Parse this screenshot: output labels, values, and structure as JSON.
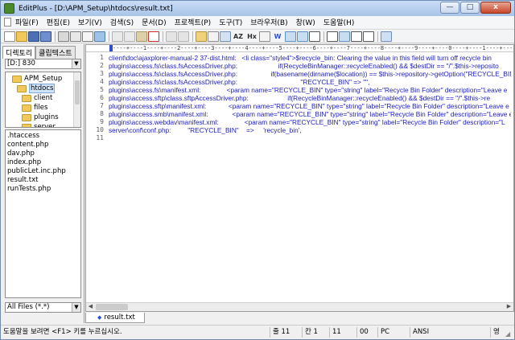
{
  "window": {
    "title": "EditPlus - [D:\\APM_Setup\\htdocs\\result.txt]",
    "buttons": {
      "minimize": "—",
      "maximize": "□",
      "close": "x"
    }
  },
  "menu": [
    "파일(F)",
    "편집(E)",
    "보기(V)",
    "검색(S)",
    "문서(D)",
    "프로젝트(P)",
    "도구(T)",
    "브라우저(B)",
    "창(W)",
    "도움말(H)"
  ],
  "toolbar": {
    "icons": [
      "new-file-icon",
      "open-file-icon",
      "save-icon",
      "save-all-icon",
      "print-icon",
      "print-preview-icon",
      "spell-check-icon",
      "find-icon",
      "cut-icon",
      "copy-icon",
      "paste-icon",
      "delete-icon",
      "undo-icon",
      "redo-icon",
      "pen-icon",
      "replace-icon",
      "goto-icon",
      "wrap-icon"
    ],
    "text_buttons": [
      "AZ",
      "Hx",
      "W"
    ]
  },
  "left_panel": {
    "tabs": [
      "디렉토리",
      "클립텍스트"
    ],
    "drive": "[D:] 830",
    "tree": [
      "APM_Setup",
      "htdocs",
      "client",
      "files",
      "plugins",
      "server"
    ],
    "files": [
      ".htaccess",
      "content.php",
      "dav.php",
      "index.php",
      "publicLet.inc.php",
      "result.txt",
      "runTests.php"
    ],
    "filter": "All Files (*.*)"
  },
  "editor": {
    "ruler": "----+----1----+----2----+----3----+----4----+----5----+----6----+----7----+----8----+----9----+----0----+----1----+----2----+",
    "line_numbers": [
      "1",
      "2",
      "3",
      "4",
      "5",
      "6",
      "7",
      "8",
      "9",
      "10",
      "11"
    ],
    "lines": [
      "client\\doc\\ajaxplorer-manual-2 37-dist.html:   <li class=\"style4\">$recycle_bin: Clearing the value in this field will turn off recycle bin",
      "plugins\\access.fs\\class.fsAccessDriver.php:                      if(RecycleBinManager::recycleEnabled() && $destDir == \"/\".$this->reposito",
      "plugins\\access.fs\\class.fsAccessDriver.php:                  if(basename(dirname($location)) == $this->repository->getOption(\"RECYCLE_BIN",
      "plugins\\access.fs\\class.fsAccessDriver.php:                                  \"RECYCLE_BIN\" => \"\",",
      "plugins\\access.fs\\manifest.xml:              <param name=\"RECYCLE_BIN\" type=\"string\" label=\"Recycle Bin Folder\" description=\"Leave e",
      "plugins\\access.sftp\\class.sftpAccessDriver.php:                     if(RecycleBinManager::recycleEnabled() && $destDir == \"/\".$this->re",
      "plugins\\access.sftp\\manifest.xml:            <param name=\"RECYCLE_BIN\" type=\"string\" label=\"Recycle Bin Folder\" description=\"Leave e",
      "plugins\\access.smb\\manifest.xml:             <param name=\"RECYCLE_BIN\" type=\"string\" label=\"Recycle Bin Folder\" description=\"Leave e",
      "plugins\\access.webdav\\manifest.xml:              <param name=\"RECYCLE_BIN\" type=\"string\" label=\"Recycle Bin Folder\" description=\"L",
      "server\\conf\\conf.php:         \"RECYCLE_BIN\"    =>     'recycle_bin',",
      ""
    ]
  },
  "doc_tab": "result.txt",
  "status": {
    "help": "도움말을 보려면 <F1> 키를 누르십시오.",
    "line": "줄 11",
    "col": "칸 1",
    "total": "11",
    "ins": "00",
    "mode": "PC",
    "encoding": "ANSI",
    "lang": "영"
  }
}
